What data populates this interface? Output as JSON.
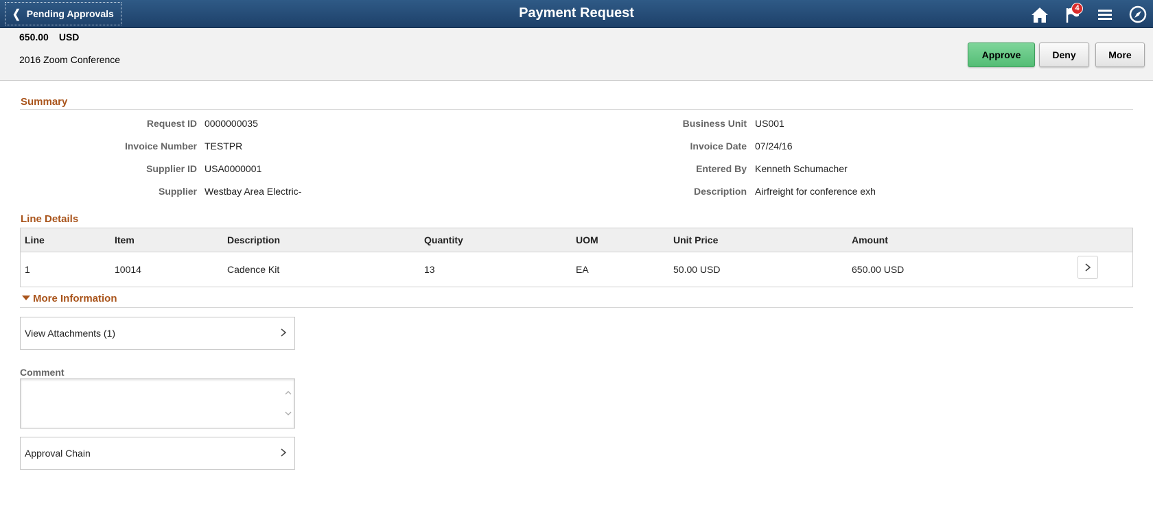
{
  "header": {
    "back_label": "Pending Approvals",
    "title": "Payment Request",
    "notification_count": "4",
    "icons": [
      "chevron-left-icon",
      "home-icon",
      "flag-icon",
      "hamburger-menu-icon",
      "compass-icon"
    ]
  },
  "request_header": {
    "amount": "650.00",
    "currency": "USD",
    "description": "2016 Zoom Conference",
    "buttons": {
      "approve": "Approve",
      "deny": "Deny",
      "more": "More"
    },
    "approve_color": "#5ec57f"
  },
  "summary": {
    "title": "Summary",
    "left": [
      {
        "label": "Request ID",
        "value": "0000000035"
      },
      {
        "label": "Invoice Number",
        "value": "TESTPR"
      },
      {
        "label": "Supplier ID",
        "value": "USA0000001"
      },
      {
        "label": "Supplier",
        "value": "Westbay Area Electric-"
      }
    ],
    "right": [
      {
        "label": "Business Unit",
        "value": "US001"
      },
      {
        "label": "Invoice Date",
        "value": "07/24/16"
      },
      {
        "label": "Entered By",
        "value": "Kenneth Schumacher"
      },
      {
        "label": "Description",
        "value": "Airfreight for conference exh"
      }
    ]
  },
  "line_details": {
    "title": "Line Details",
    "columns": [
      "Line",
      "Item",
      "Description",
      "Quantity",
      "UOM",
      "Unit Price",
      "Amount"
    ],
    "rows": [
      [
        "1",
        "10014",
        "Cadence Kit",
        "13",
        "EA",
        "50.00 USD",
        "650.00 USD"
      ]
    ]
  },
  "more_information": {
    "title": "More Information",
    "attachments_label": "View Attachments (1)",
    "comment_label": "Comment",
    "comment_value": "",
    "approval_chain_label": "Approval Chain"
  },
  "colors": {
    "header_bg": "#24496f",
    "section_title": "#a9541b",
    "badge": "#d92b2b"
  }
}
